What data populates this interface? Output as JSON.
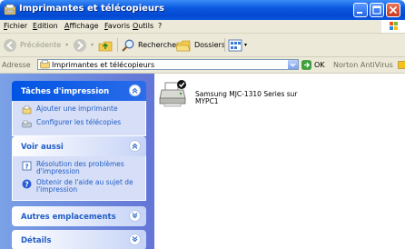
{
  "window": {
    "title": "Imprimantes et télécopieurs"
  },
  "menu": [
    "Fichier",
    "Edition",
    "Affichage",
    "Favoris",
    "Outils",
    "?"
  ],
  "toolbar": {
    "back_label": "Précédente",
    "search_label": "Rechercher",
    "folders_label": "Dossiers"
  },
  "address": {
    "label": "Adresse",
    "value": "Imprimantes et télécopieurs",
    "go_label": "OK",
    "norton_label": "Norton AntiVirus"
  },
  "sidebar": {
    "panels": [
      {
        "title": "Tâches d'impression",
        "items": [
          "Ajouter une imprimante",
          "Configurer les télécopies"
        ]
      },
      {
        "title": "Voir aussi",
        "items": [
          "Résolution des problèmes d'impression",
          "Obtenir de l'aide au sujet de l'impression"
        ]
      },
      {
        "title": "Autres emplacements"
      },
      {
        "title": "Détails"
      }
    ]
  },
  "printers": [
    {
      "name_line1": "Samsung MJC-1310 Series sur",
      "name_line2": "MYPC1",
      "is_default": true
    }
  ],
  "colors": {
    "titlebar": "#0a58de",
    "sidebar": "#6d8be2",
    "link": "#215dc6",
    "panel_body": "#d6dff7"
  }
}
